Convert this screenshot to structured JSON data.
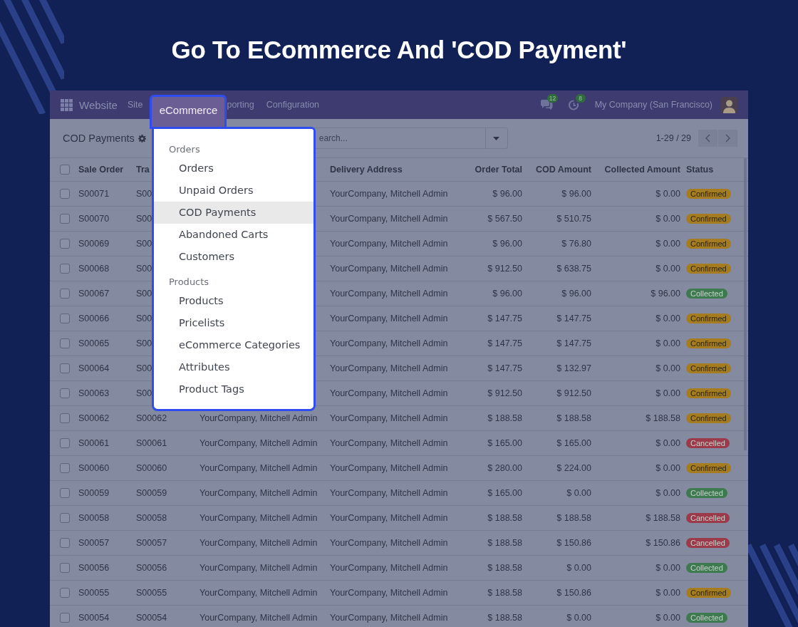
{
  "heading": "Go To ECommerce And 'COD Payment'",
  "navbar": {
    "app_name": "Website",
    "items": [
      {
        "label": "Site",
        "selected": false
      },
      {
        "label": "eCommerce",
        "selected": true
      },
      {
        "label": "porting",
        "selected": false
      },
      {
        "label": "Configuration",
        "selected": false
      }
    ],
    "messages_badge": "12",
    "activities_badge": "8",
    "company": "My Company (San Francisco)"
  },
  "dropdown": {
    "sections": [
      {
        "title": "Orders",
        "items": [
          {
            "label": "Orders",
            "selected": false
          },
          {
            "label": "Unpaid Orders",
            "selected": false
          },
          {
            "label": "COD Payments",
            "selected": true
          },
          {
            "label": "Abandoned Carts",
            "selected": false
          },
          {
            "label": "Customers",
            "selected": false
          }
        ]
      },
      {
        "title": "Products",
        "items": [
          {
            "label": "Products",
            "selected": false
          },
          {
            "label": "Pricelists",
            "selected": false
          },
          {
            "label": "eCommerce Categories",
            "selected": false
          },
          {
            "label": "Attributes",
            "selected": false
          },
          {
            "label": "Product Tags",
            "selected": false
          }
        ]
      }
    ]
  },
  "control_bar": {
    "title": "COD Payments",
    "search": {
      "placeholder": "earch..."
    },
    "pager": "1-29 / 29"
  },
  "table": {
    "select_all_checked": false,
    "columns": [
      "Sale Order",
      "Tra",
      "",
      "Delivery Address",
      "Order Total",
      "COD Amount",
      "Collected Amount",
      "Status"
    ],
    "rows": [
      {
        "checked": false,
        "sale_order": "S00071",
        "transaction": "S00",
        "delivery": "YourCompany, Mitchell Admin",
        "order_total": "$ 96.00",
        "cod_amount": "$ 96.00",
        "collected": "$ 0.00",
        "status": {
          "label": "Confirmed",
          "color": "#a57c1f"
        }
      },
      {
        "checked": false,
        "sale_order": "S00070",
        "transaction": "S00",
        "delivery": "YourCompany, Mitchell Admin",
        "order_total": "$ 567.50",
        "cod_amount": "$ 510.75",
        "collected": "$ 0.00",
        "status": {
          "label": "Confirmed",
          "color": "#a57c1f"
        }
      },
      {
        "checked": false,
        "sale_order": "S00069",
        "transaction": "S00",
        "delivery": "YourCompany, Mitchell Admin",
        "order_total": "$ 96.00",
        "cod_amount": "$ 76.80",
        "collected": "$ 0.00",
        "status": {
          "label": "Confirmed",
          "color": "#a57c1f"
        }
      },
      {
        "checked": false,
        "sale_order": "S00068",
        "transaction": "S00",
        "delivery": "YourCompany, Mitchell Admin",
        "order_total": "$ 912.50",
        "cod_amount": "$ 638.75",
        "collected": "$ 0.00",
        "status": {
          "label": "Confirmed",
          "color": "#a57c1f"
        }
      },
      {
        "checked": false,
        "sale_order": "S00067",
        "transaction": "S00",
        "delivery": "YourCompany, Mitchell Admin",
        "order_total": "$ 96.00",
        "cod_amount": "$ 96.00",
        "collected": "$ 96.00",
        "status": {
          "label": "Collected",
          "color": "#3d7a4f"
        }
      },
      {
        "checked": false,
        "sale_order": "S00066",
        "transaction": "S00",
        "delivery": "YourCompany, Mitchell Admin",
        "order_total": "$ 147.75",
        "cod_amount": "$ 147.75",
        "collected": "$ 0.00",
        "status": {
          "label": "Confirmed",
          "color": "#a57c1f"
        }
      },
      {
        "checked": false,
        "sale_order": "S00065",
        "transaction": "S00",
        "delivery": "YourCompany, Mitchell Admin",
        "order_total": "$ 147.75",
        "cod_amount": "$ 147.75",
        "collected": "$ 0.00",
        "status": {
          "label": "Confirmed",
          "color": "#a57c1f"
        }
      },
      {
        "checked": false,
        "sale_order": "S00064",
        "transaction": "S00",
        "delivery": "YourCompany, Mitchell Admin",
        "order_total": "$ 147.75",
        "cod_amount": "$ 132.97",
        "collected": "$ 0.00",
        "status": {
          "label": "Confirmed",
          "color": "#a57c1f"
        }
      },
      {
        "checked": false,
        "sale_order": "S00063",
        "transaction": "S00",
        "delivery": "YourCompany, Mitchell Admin",
        "order_total": "$ 912.50",
        "cod_amount": "$ 912.50",
        "collected": "$ 0.00",
        "status": {
          "label": "Confirmed",
          "color": "#a57c1f"
        }
      },
      {
        "checked": false,
        "sale_order": "S00062",
        "transaction": "S00062",
        "customer": "YourCompany, Mitchell Admin",
        "delivery": "YourCompany, Mitchell Admin",
        "order_total": "$ 188.58",
        "cod_amount": "$ 188.58",
        "collected": "$ 188.58",
        "status": {
          "label": "Confirmed",
          "color": "#a57c1f"
        }
      },
      {
        "checked": false,
        "sale_order": "S00061",
        "transaction": "S00061",
        "customer": "YourCompany, Mitchell Admin",
        "delivery": "YourCompany, Mitchell Admin",
        "order_total": "$ 165.00",
        "cod_amount": "$ 165.00",
        "collected": "$ 0.00",
        "status": {
          "label": "Cancelled",
          "color": "#9b3a4a"
        }
      },
      {
        "checked": false,
        "sale_order": "S00060",
        "transaction": "S00060",
        "customer": "YourCompany, Mitchell Admin",
        "delivery": "YourCompany, Mitchell Admin",
        "order_total": "$ 280.00",
        "cod_amount": "$ 224.00",
        "collected": "$ 0.00",
        "status": {
          "label": "Confirmed",
          "color": "#a57c1f"
        }
      },
      {
        "checked": false,
        "sale_order": "S00059",
        "transaction": "S00059",
        "customer": "YourCompany, Mitchell Admin",
        "delivery": "YourCompany, Mitchell Admin",
        "order_total": "$ 165.00",
        "cod_amount": "$ 0.00",
        "collected": "$ 0.00",
        "status": {
          "label": "Collected",
          "color": "#3d7a4f"
        }
      },
      {
        "checked": false,
        "sale_order": "S00058",
        "transaction": "S00058",
        "customer": "YourCompany, Mitchell Admin",
        "delivery": "YourCompany, Mitchell Admin",
        "order_total": "$ 188.58",
        "cod_amount": "$ 188.58",
        "collected": "$ 188.58",
        "status": {
          "label": "Cancelled",
          "color": "#9b3a4a"
        }
      },
      {
        "checked": false,
        "sale_order": "S00057",
        "transaction": "S00057",
        "customer": "YourCompany, Mitchell Admin",
        "delivery": "YourCompany, Mitchell Admin",
        "order_total": "$ 188.58",
        "cod_amount": "$ 150.86",
        "collected": "$ 150.86",
        "status": {
          "label": "Cancelled",
          "color": "#9b3a4a"
        }
      },
      {
        "checked": false,
        "sale_order": "S00056",
        "transaction": "S00056",
        "customer": "YourCompany, Mitchell Admin",
        "delivery": "YourCompany, Mitchell Admin",
        "order_total": "$ 188.58",
        "cod_amount": "$ 0.00",
        "collected": "$ 0.00",
        "status": {
          "label": "Collected",
          "color": "#3d7a4f"
        }
      },
      {
        "checked": false,
        "sale_order": "S00055",
        "transaction": "S00055",
        "customer": "YourCompany, Mitchell Admin",
        "delivery": "YourCompany, Mitchell Admin",
        "order_total": "$ 188.58",
        "cod_amount": "$ 150.86",
        "collected": "$ 0.00",
        "status": {
          "label": "Confirmed",
          "color": "#a57c1f"
        }
      },
      {
        "checked": false,
        "sale_order": "S00054",
        "transaction": "S00054",
        "customer": "YourCompany, Mitchell Admin",
        "delivery": "YourCompany, Mitchell Admin",
        "order_total": "$ 188.58",
        "cod_amount": "$ 0.00",
        "collected": "$ 0.00",
        "status": {
          "label": "Collected",
          "color": "#3d7a4f"
        }
      }
    ]
  }
}
